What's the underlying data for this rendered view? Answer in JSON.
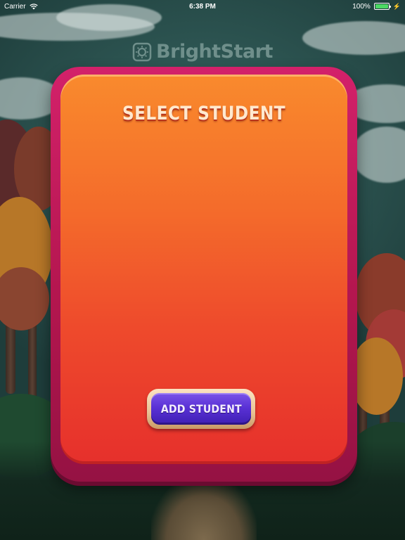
{
  "status_bar": {
    "carrier": "Carrier",
    "time": "6:38 PM",
    "battery_percent": "100%",
    "battery_level": 1.0,
    "icons": [
      "wifi-icon",
      "battery-icon",
      "charging-icon"
    ]
  },
  "logo": {
    "text": "BrightStart",
    "icon": "brightstart-logo-icon"
  },
  "card": {
    "title": "SELECT STUDENT",
    "add_button_label": "ADD STUDENT"
  },
  "colors": {
    "card_border": "#c41a5e",
    "card_face_top": "#f98a2d",
    "card_face_bottom": "#e6302c",
    "title_text": "#ffe9cf",
    "button_face": "#5a31d6",
    "button_rim": "#e8c193",
    "background": "#2d5552"
  }
}
